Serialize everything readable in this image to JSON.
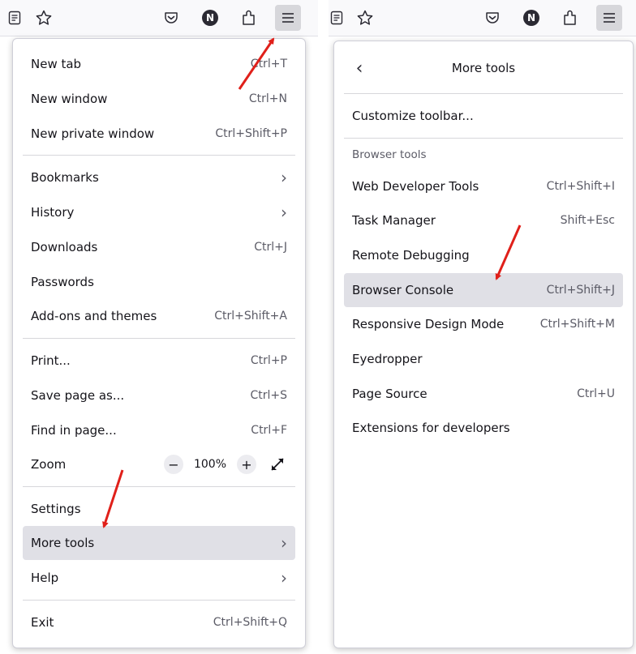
{
  "left": {
    "menu": {
      "items": [
        {
          "label": "New tab",
          "shortcut": "Ctrl+T"
        },
        {
          "label": "New window",
          "shortcut": "Ctrl+N"
        },
        {
          "label": "New private window",
          "shortcut": "Ctrl+Shift+P"
        },
        {
          "label": "Bookmarks",
          "submenu": true
        },
        {
          "label": "History",
          "submenu": true
        },
        {
          "label": "Downloads",
          "shortcut": "Ctrl+J"
        },
        {
          "label": "Passwords"
        },
        {
          "label": "Add-ons and themes",
          "shortcut": "Ctrl+Shift+A"
        },
        {
          "label": "Print...",
          "shortcut": "Ctrl+P"
        },
        {
          "label": "Save page as...",
          "shortcut": "Ctrl+S"
        },
        {
          "label": "Find in page...",
          "shortcut": "Ctrl+F"
        },
        {
          "label": "Zoom",
          "zoom_value": "100%",
          "zoom_minus": "−",
          "zoom_plus": "+"
        },
        {
          "label": "Settings"
        },
        {
          "label": "More tools",
          "submenu": true
        },
        {
          "label": "Help",
          "submenu": true
        },
        {
          "label": "Exit",
          "shortcut": "Ctrl+Shift+Q"
        }
      ]
    },
    "toolbar": {
      "icons": [
        "reader-view-icon",
        "bookmark-star-icon",
        "pocket-icon",
        "account-avatar-icon",
        "extensions-icon",
        "hamburger-menu-icon"
      ],
      "avatar_letter": "N"
    }
  },
  "right": {
    "title": "More tools",
    "back_icon": "chevron-left-icon",
    "customize": "Customize toolbar...",
    "section_label": "Browser tools",
    "items": [
      {
        "label": "Web Developer Tools",
        "shortcut": "Ctrl+Shift+I"
      },
      {
        "label": "Task Manager",
        "shortcut": "Shift+Esc"
      },
      {
        "label": "Remote Debugging",
        "shortcut": ""
      },
      {
        "label": "Browser Console",
        "shortcut": "Ctrl+Shift+J"
      },
      {
        "label": "Responsive Design Mode",
        "shortcut": "Ctrl+Shift+M"
      },
      {
        "label": "Eyedropper",
        "shortcut": ""
      },
      {
        "label": "Page Source",
        "shortcut": "Ctrl+U"
      },
      {
        "label": "Extensions for developers",
        "shortcut": ""
      }
    ],
    "toolbar": {
      "avatar_letter": "N"
    }
  },
  "colors": {
    "highlight": "#e0e0e6",
    "annotation_arrow": "#e0201a",
    "active_toolbar_button": "#d7d7db"
  }
}
